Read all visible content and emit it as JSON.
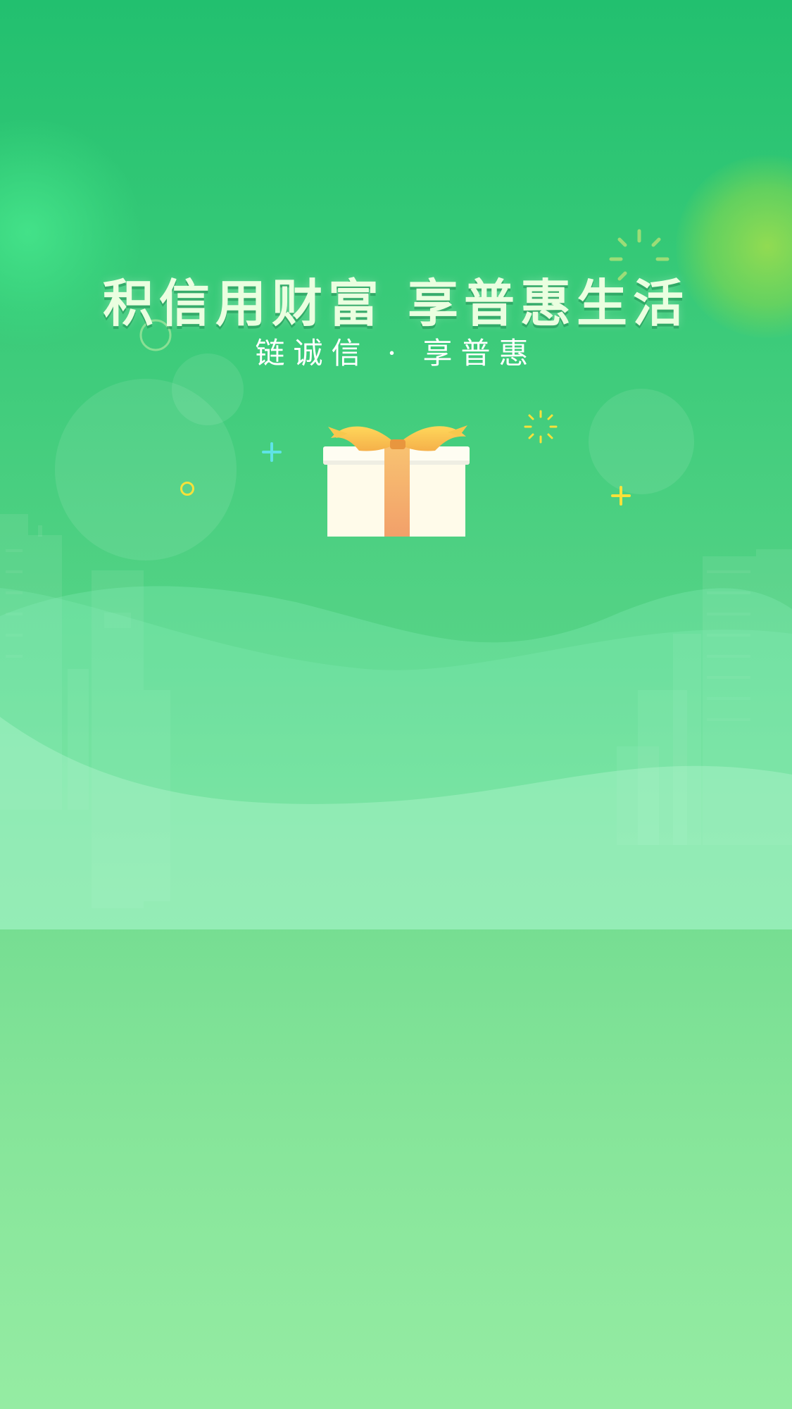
{
  "banner": {
    "headline": "积信用财富 享普惠生活",
    "subline": "链诚信 · 享普惠"
  },
  "icons": {
    "gift": "gift-box-icon",
    "plus_cyan": "plus-sparkle-icon",
    "plus_yellow": "plus-sparkle-icon",
    "ring": "ring-icon",
    "burst": "sparkle-burst-icon"
  },
  "colors": {
    "background_top": "#22c06f",
    "background_bottom": "#95eca3",
    "headline": "#eaffe0",
    "ribbon": "#f5b06a",
    "accent_yellow": "#f7e13a",
    "accent_cyan": "#5fe3e6"
  }
}
